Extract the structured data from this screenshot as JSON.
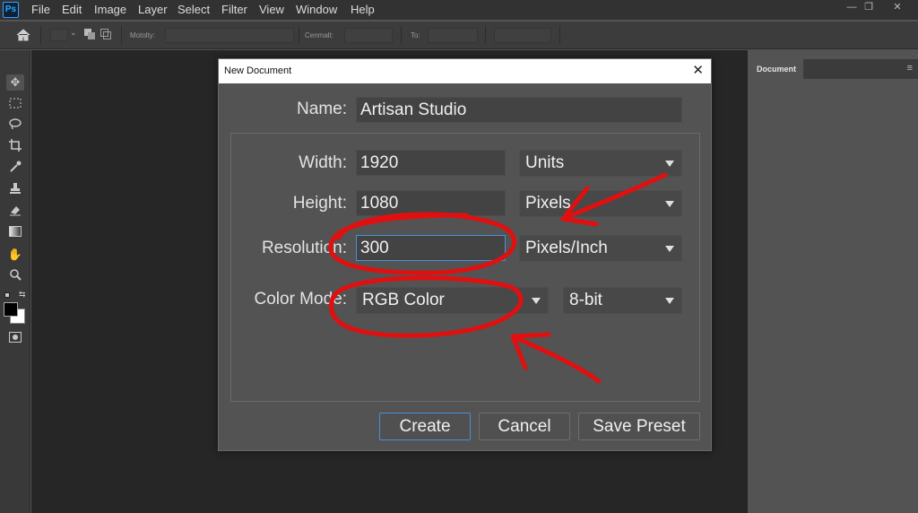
{
  "app": {
    "logo": "Ps"
  },
  "menubar": {
    "items": [
      "File",
      "Edit",
      "Image",
      "Layer",
      "Select",
      "Filter",
      "View",
      "Window",
      "Help"
    ]
  },
  "window_controls": {
    "minimize": "—",
    "restore": "❐",
    "close": "✕"
  },
  "optionsbar": {
    "label1": "Motolty:",
    "label2": "Cenmalt:",
    "label3": "To:"
  },
  "right_panel": {
    "tab": "Document",
    "menu": "≡"
  },
  "dialog": {
    "title": "New Document",
    "close": "✕",
    "name_label": "Name:",
    "name_value": "Artisan Studio",
    "width_label": "Width:",
    "width_value": "1920",
    "width_unit": "Units",
    "height_label": "Height:",
    "height_value": "1080",
    "height_unit": "Pixels",
    "resolution_label": "Resolution:",
    "resolution_value": "300",
    "resolution_unit": "Pixels/Inch",
    "color_mode_label": "Color Mode:",
    "color_mode_value": "RGB Color",
    "bit_depth_value": "8-bit",
    "create_label": "Create",
    "cancel_label": "Cancel",
    "save_preset_label": "Save Preset"
  },
  "colors": {
    "annotation": "#e01010",
    "focus": "#4a8fd8",
    "accent": "#31a8ff"
  }
}
